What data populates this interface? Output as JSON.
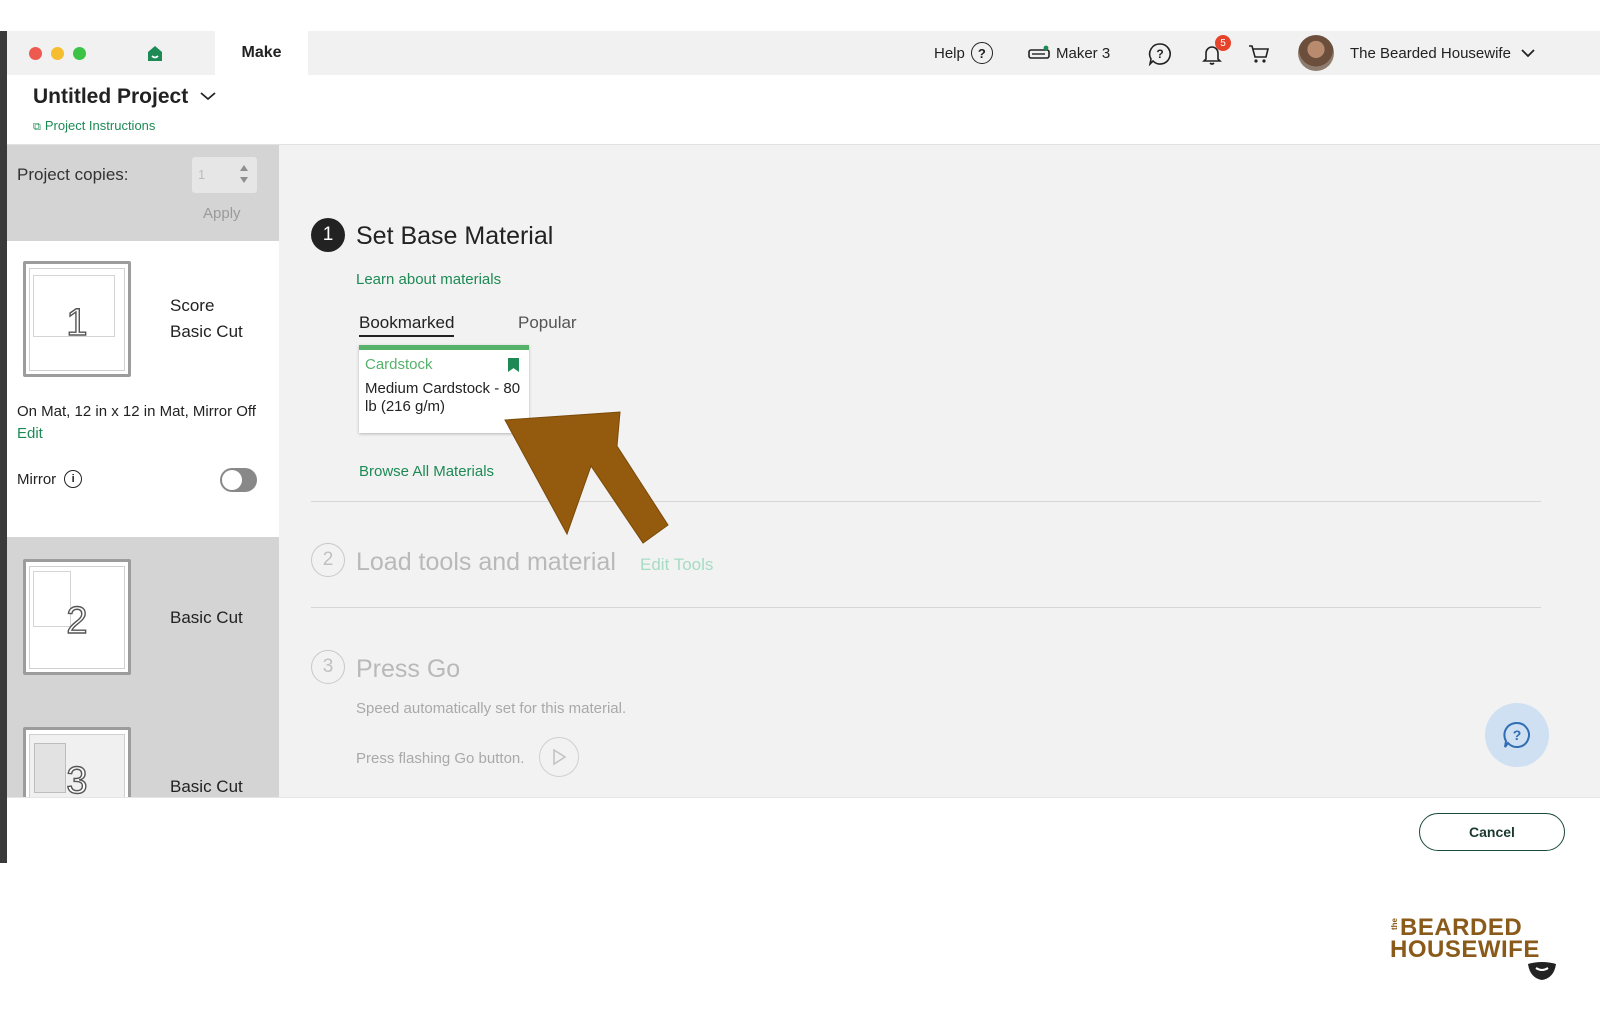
{
  "titlebar": {
    "make_tab": "Make",
    "help_label": "Help",
    "machine_label": "Maker 3",
    "notification_count": "5",
    "user_name": "The Bearded Housewife"
  },
  "project": {
    "title": "Untitled Project",
    "instructions_link": "Project Instructions"
  },
  "sidebar": {
    "copies_label": "Project copies:",
    "copies_value": "1",
    "apply_label": "Apply",
    "mats": [
      {
        "number": "1",
        "lines": [
          "Score",
          "Basic Cut"
        ]
      },
      {
        "number": "2",
        "lines": [
          "Basic Cut"
        ]
      },
      {
        "number": "3",
        "lines": [
          "Basic Cut"
        ]
      }
    ],
    "mat_info": "On Mat, 12 in x 12 in Mat, Mirror Off",
    "edit_label": "Edit",
    "mirror_label": "Mirror",
    "mirror_on": false
  },
  "steps": {
    "step1": {
      "number": "1",
      "title": "Set Base Material",
      "learn_link": "Learn about materials",
      "tabs": [
        "Bookmarked",
        "Popular"
      ],
      "active_tab": "Bookmarked",
      "material": {
        "category": "Cardstock",
        "name": "Medium Cardstock - 80 lb (216 g/m)"
      },
      "browse_link": "Browse All Materials"
    },
    "step2": {
      "number": "2",
      "title": "Load tools and material",
      "edit_tools": "Edit Tools"
    },
    "step3": {
      "number": "3",
      "title": "Press Go",
      "speed_note": "Speed automatically set for this material.",
      "press_note": "Press flashing Go button."
    }
  },
  "footer": {
    "cancel_label": "Cancel"
  },
  "watermark": {
    "small": "the",
    "line1": "BEARDED",
    "line2": "HOUSEWIFE"
  },
  "colors": {
    "accent_green": "#1d8a55",
    "tile_green": "#56b26a",
    "arrow_brown": "#945a0d",
    "notification_red": "#e5432a"
  },
  "icons": [
    "home-icon",
    "help-circle-icon",
    "machine-icon",
    "support-chat-icon",
    "bell-icon",
    "cart-icon",
    "chevron-down-icon",
    "bookmark-icon",
    "info-icon",
    "play-icon",
    "help-fab-icon"
  ]
}
